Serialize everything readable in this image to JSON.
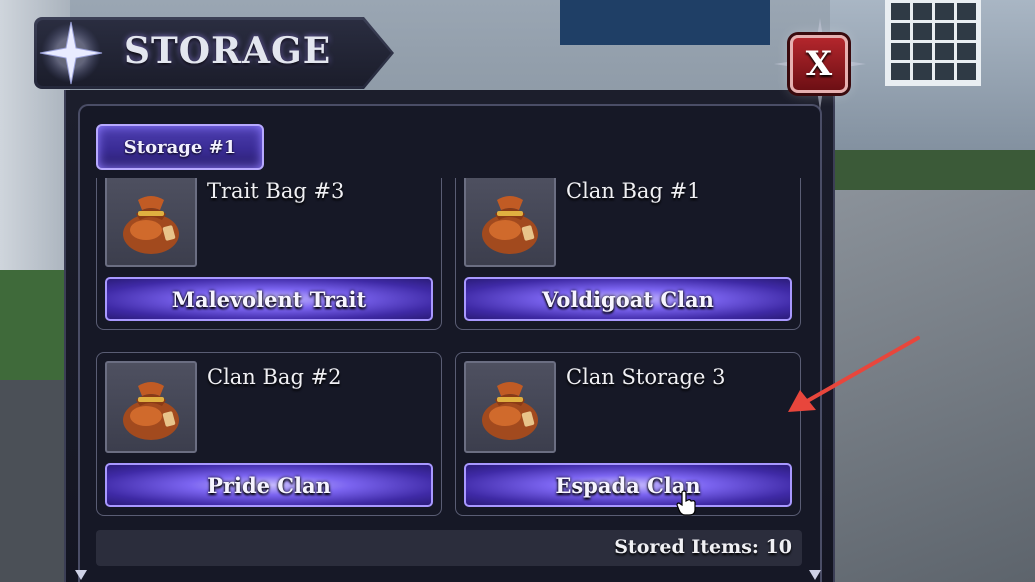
{
  "header": {
    "title": "STORAGE",
    "close_label": "X"
  },
  "tabs": [
    {
      "label": "Storage #1",
      "active": true
    }
  ],
  "slots": [
    {
      "name": "Trait Bag #3",
      "button": "Malevolent Trait",
      "icon": "bag-icon"
    },
    {
      "name": "Clan Bag #1",
      "button": "Voldigoat Clan",
      "icon": "bag-icon"
    },
    {
      "name": "Clan Bag #2",
      "button": "Pride Clan",
      "icon": "bag-icon"
    },
    {
      "name": "Clan Storage 3",
      "button": "Espada Clan",
      "icon": "bag-icon"
    }
  ],
  "footer": {
    "stored_items": "Stored Items: 10"
  },
  "colors": {
    "accent": "#6f57e8",
    "close": "#b3262c",
    "annotation": "#e8463c"
  }
}
